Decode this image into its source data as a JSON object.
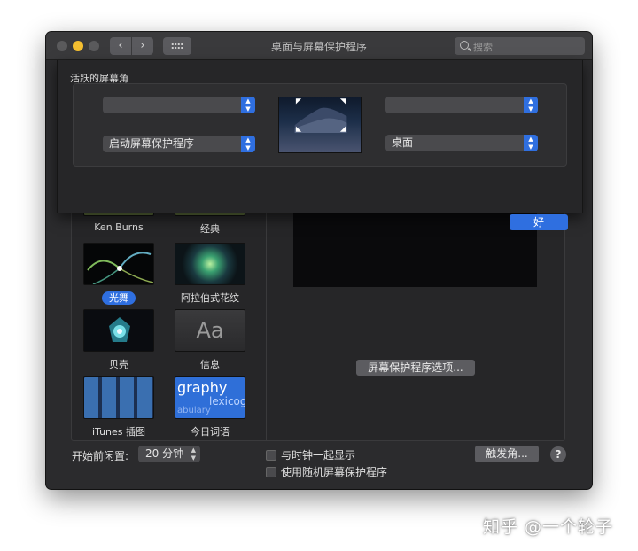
{
  "window": {
    "title": "桌面与屏幕保护程序",
    "search_placeholder": "搜索"
  },
  "hot_corners_sheet": {
    "group_label": "活跃的屏幕角",
    "top_left": "-",
    "top_right": "-",
    "bottom_left": "启动屏幕保护程序",
    "bottom_right": "桌面",
    "ok_label": "好"
  },
  "savers": [
    {
      "label": "Ken Burns"
    },
    {
      "label": "经典"
    },
    {
      "label": "光舞"
    },
    {
      "label": "阿拉伯式花纹"
    },
    {
      "label": "贝壳"
    },
    {
      "label": "信息"
    },
    {
      "label": "iTunes 插图"
    },
    {
      "label": "今日词语"
    }
  ],
  "info_thumb_text": "Aa",
  "word_thumb": {
    "line1": "graphy",
    "line2": "lexicog",
    "line3": "abulary"
  },
  "saver_options_label": "屏幕保护程序选项...",
  "bottom": {
    "idle_label": "开始前闲置:",
    "idle_value": "20 分钟",
    "show_clock_label": "与时钟一起显示",
    "random_label": "使用随机屏幕保护程序",
    "hot_corners_label": "触发角...",
    "help_label": "?"
  },
  "watermark": "知乎 @一个轮子",
  "colors": {
    "accent": "#2f6fe0",
    "window_bg": "#2b2b2d"
  }
}
